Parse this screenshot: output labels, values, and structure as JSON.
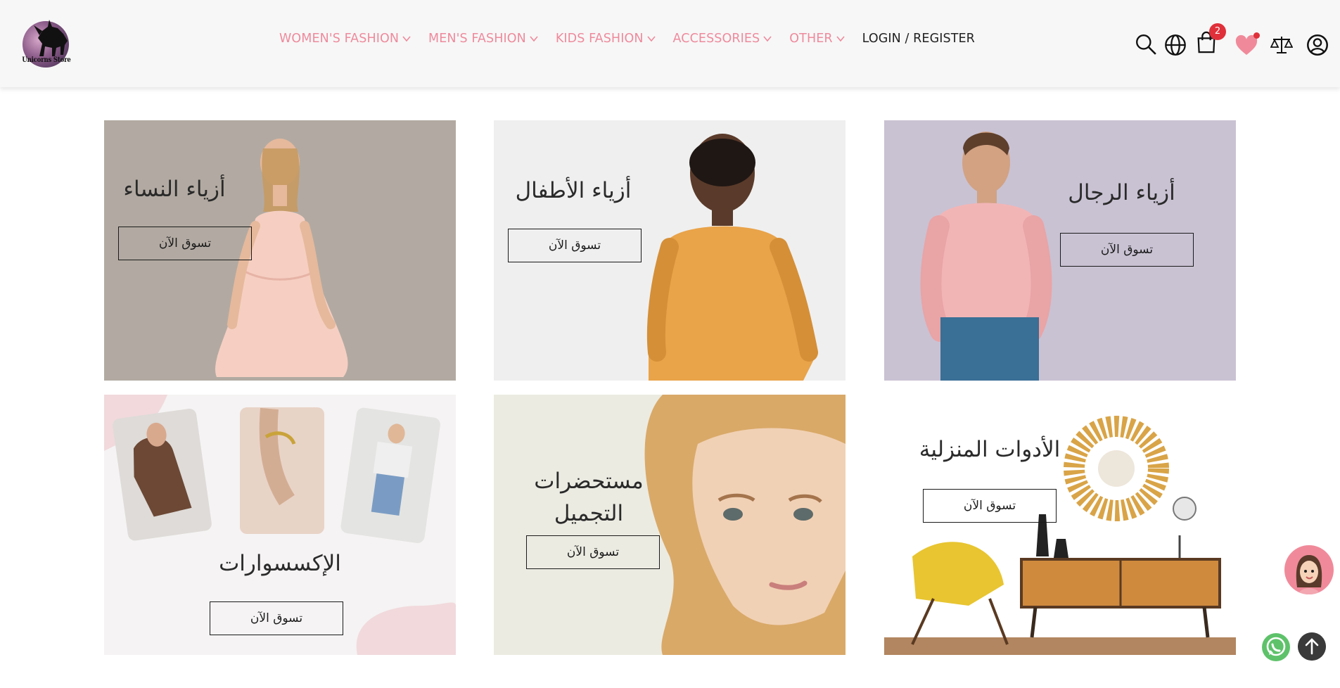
{
  "header": {
    "logo_text": "Unicorns Store",
    "nav": [
      {
        "label": "WOMEN'S FASHION",
        "has_dropdown": true
      },
      {
        "label": "MEN'S FASHION",
        "has_dropdown": true
      },
      {
        "label": "KIDS FASHION",
        "has_dropdown": true
      },
      {
        "label": "ACCESSORIES",
        "has_dropdown": true
      },
      {
        "label": "OTHER",
        "has_dropdown": true
      },
      {
        "label": "LOGIN / REGISTER",
        "has_dropdown": false
      }
    ],
    "icons": [
      "search-icon",
      "globe-icon",
      "shopping-bag-icon",
      "heart-icon",
      "compare-scale-icon",
      "user-icon"
    ],
    "cart_count": "2",
    "nav_color": "#ee8a9c",
    "badge_color": "#e0303a"
  },
  "categories": [
    {
      "title": "أزياء النساء",
      "button": "تسوق الآن"
    },
    {
      "title": "أزياء الأطفال",
      "button": "تسوق الآن"
    },
    {
      "title": "أزياء الرجال",
      "button": "تسوق الآن"
    },
    {
      "title": "الإكسسوارات",
      "button": "تسوق الآن"
    },
    {
      "title_line1": "مستحضرات",
      "title_line2": "التجميل",
      "button": "تسوق الآن"
    },
    {
      "title": "الأدوات المنزلية",
      "button": "تسوق الآن"
    }
  ],
  "floating": {
    "chat": "chat-assistant-icon",
    "whatsapp": "whatsapp-icon",
    "scroll_top": "arrow-up-icon"
  }
}
